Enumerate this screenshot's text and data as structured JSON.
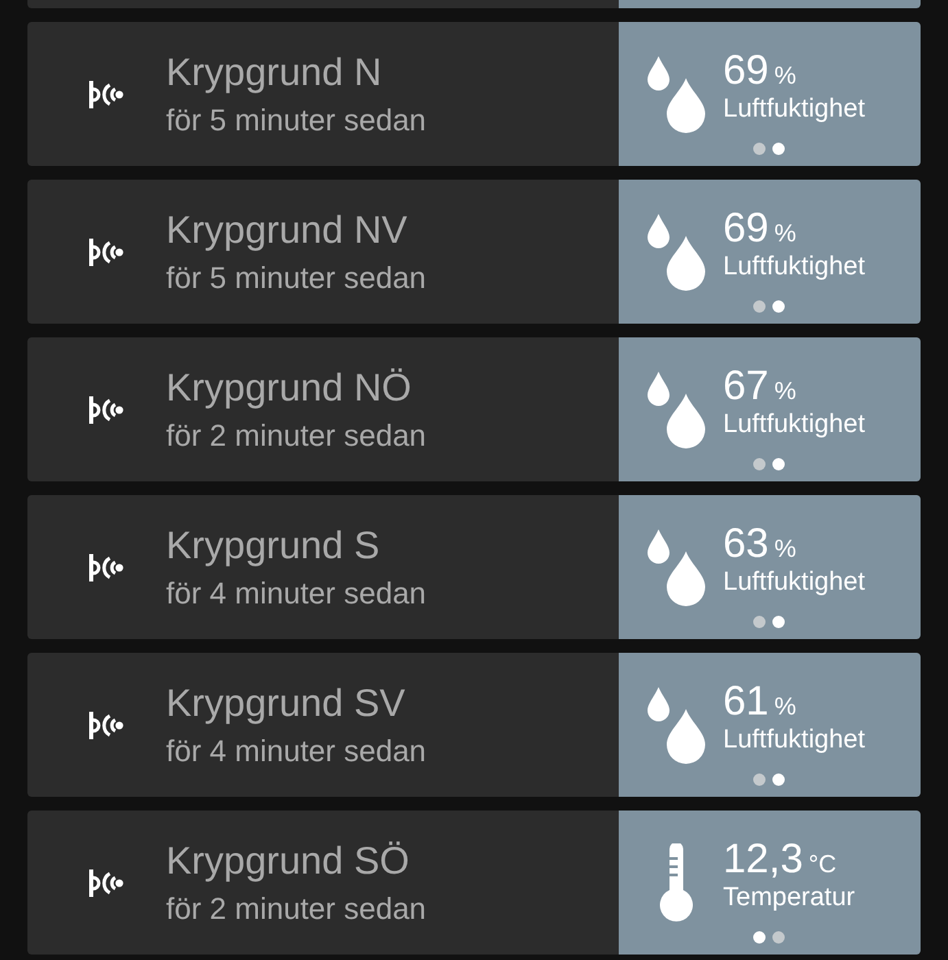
{
  "sensors": [
    {
      "name": "Krypgrund N",
      "updated": "för 5 minuter sedan",
      "reading": {
        "kind": "humidity",
        "value": "69",
        "unit": "%",
        "label": "Luftfuktighet"
      },
      "pages": [
        {
          "selected": false
        },
        {
          "selected": true
        }
      ]
    },
    {
      "name": "Krypgrund NV",
      "updated": "för 5 minuter sedan",
      "reading": {
        "kind": "humidity",
        "value": "69",
        "unit": "%",
        "label": "Luftfuktighet"
      },
      "pages": [
        {
          "selected": false
        },
        {
          "selected": true
        }
      ]
    },
    {
      "name": "Krypgrund NÖ",
      "updated": "för 2 minuter sedan",
      "reading": {
        "kind": "humidity",
        "value": "67",
        "unit": "%",
        "label": "Luftfuktighet"
      },
      "pages": [
        {
          "selected": false
        },
        {
          "selected": true
        }
      ]
    },
    {
      "name": "Krypgrund S",
      "updated": "för 4 minuter sedan",
      "reading": {
        "kind": "humidity",
        "value": "63",
        "unit": "%",
        "label": "Luftfuktighet"
      },
      "pages": [
        {
          "selected": false
        },
        {
          "selected": true
        }
      ]
    },
    {
      "name": "Krypgrund SV",
      "updated": "för 4 minuter sedan",
      "reading": {
        "kind": "humidity",
        "value": "61",
        "unit": "%",
        "label": "Luftfuktighet"
      },
      "pages": [
        {
          "selected": false
        },
        {
          "selected": true
        }
      ]
    },
    {
      "name": "Krypgrund SÖ",
      "updated": "för 2 minuter sedan",
      "reading": {
        "kind": "temperature",
        "value": "12,3",
        "unit": "°C",
        "label": "Temperatur"
      },
      "pages": [
        {
          "selected": true
        },
        {
          "selected": false
        }
      ]
    }
  ]
}
